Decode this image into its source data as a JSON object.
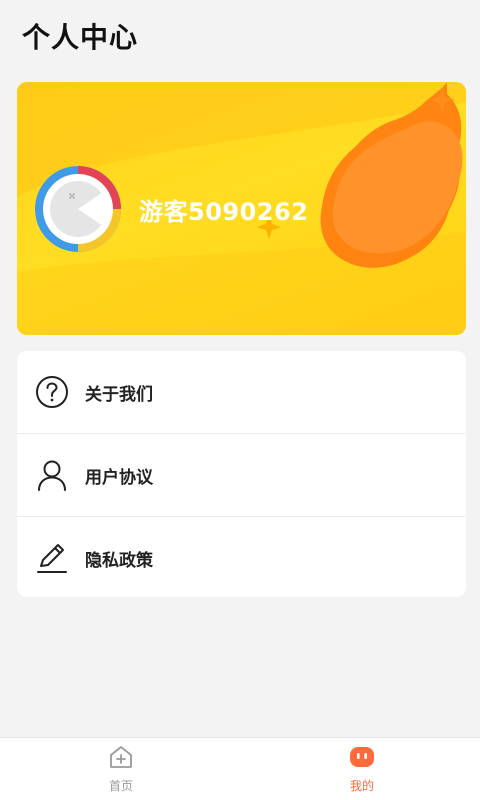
{
  "header": {
    "title": "个人中心"
  },
  "profile": {
    "username": "游客5090262"
  },
  "menu": {
    "items": [
      {
        "label": "关于我们",
        "icon": "question-circle-icon"
      },
      {
        "label": "用户协议",
        "icon": "user-icon"
      },
      {
        "label": "隐私政策",
        "icon": "pencil-icon"
      }
    ]
  },
  "tabbar": {
    "home_label": "首页",
    "mine_label": "我的",
    "active": "我的"
  },
  "colors": {
    "card_yellow": "#ffd21a",
    "accent_orange": "#ff6a3d",
    "leaf_orange": "#ff8a20"
  }
}
